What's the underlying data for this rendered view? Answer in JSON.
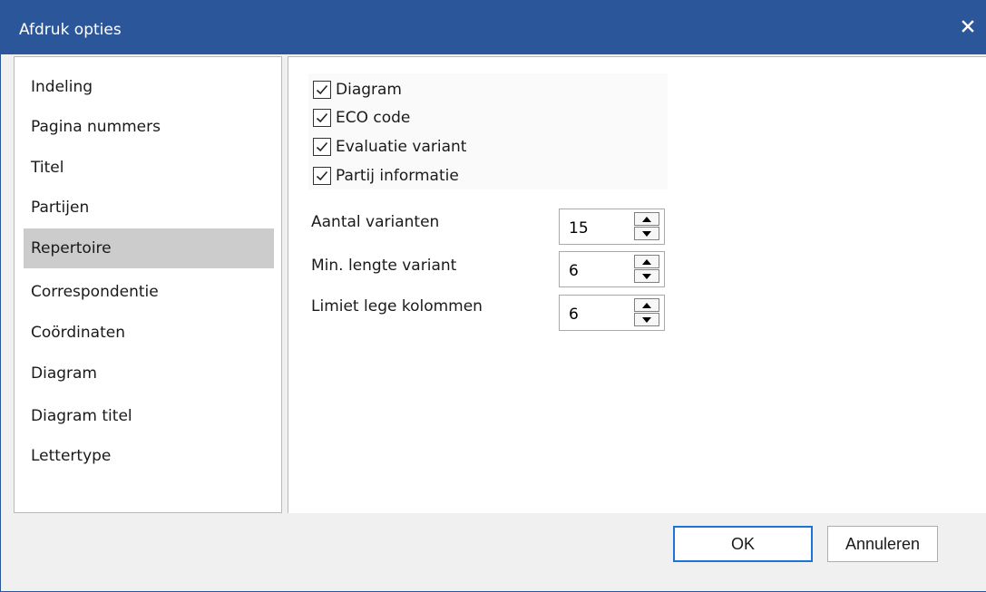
{
  "window": {
    "title": "Afdruk opties",
    "close_icon": "close-icon",
    "accent_color": "#2b579a"
  },
  "sidebar": {
    "selected_index": 4,
    "items": [
      {
        "label": "Indeling"
      },
      {
        "label": "Pagina nummers"
      },
      {
        "label": "Titel"
      },
      {
        "label": "Partijen"
      },
      {
        "label": "Repertoire"
      },
      {
        "label": "Correspondentie"
      },
      {
        "label": "Coördinaten"
      },
      {
        "label": "Diagram"
      },
      {
        "label": "Diagram titel"
      },
      {
        "label": "Lettertype"
      }
    ]
  },
  "options": {
    "checkboxes": [
      {
        "label": "Diagram",
        "checked": true
      },
      {
        "label": "ECO code",
        "checked": true
      },
      {
        "label": "Evaluatie variant",
        "checked": true
      },
      {
        "label": "Partij informatie",
        "checked": true
      }
    ],
    "fields": [
      {
        "label": "Aantal varianten",
        "value": "15"
      },
      {
        "label": "Min. lengte variant",
        "value": "6"
      },
      {
        "label": "Limiet lege kolommen",
        "value": "6"
      }
    ]
  },
  "footer": {
    "ok_label": "OK",
    "cancel_label": "Annuleren"
  }
}
